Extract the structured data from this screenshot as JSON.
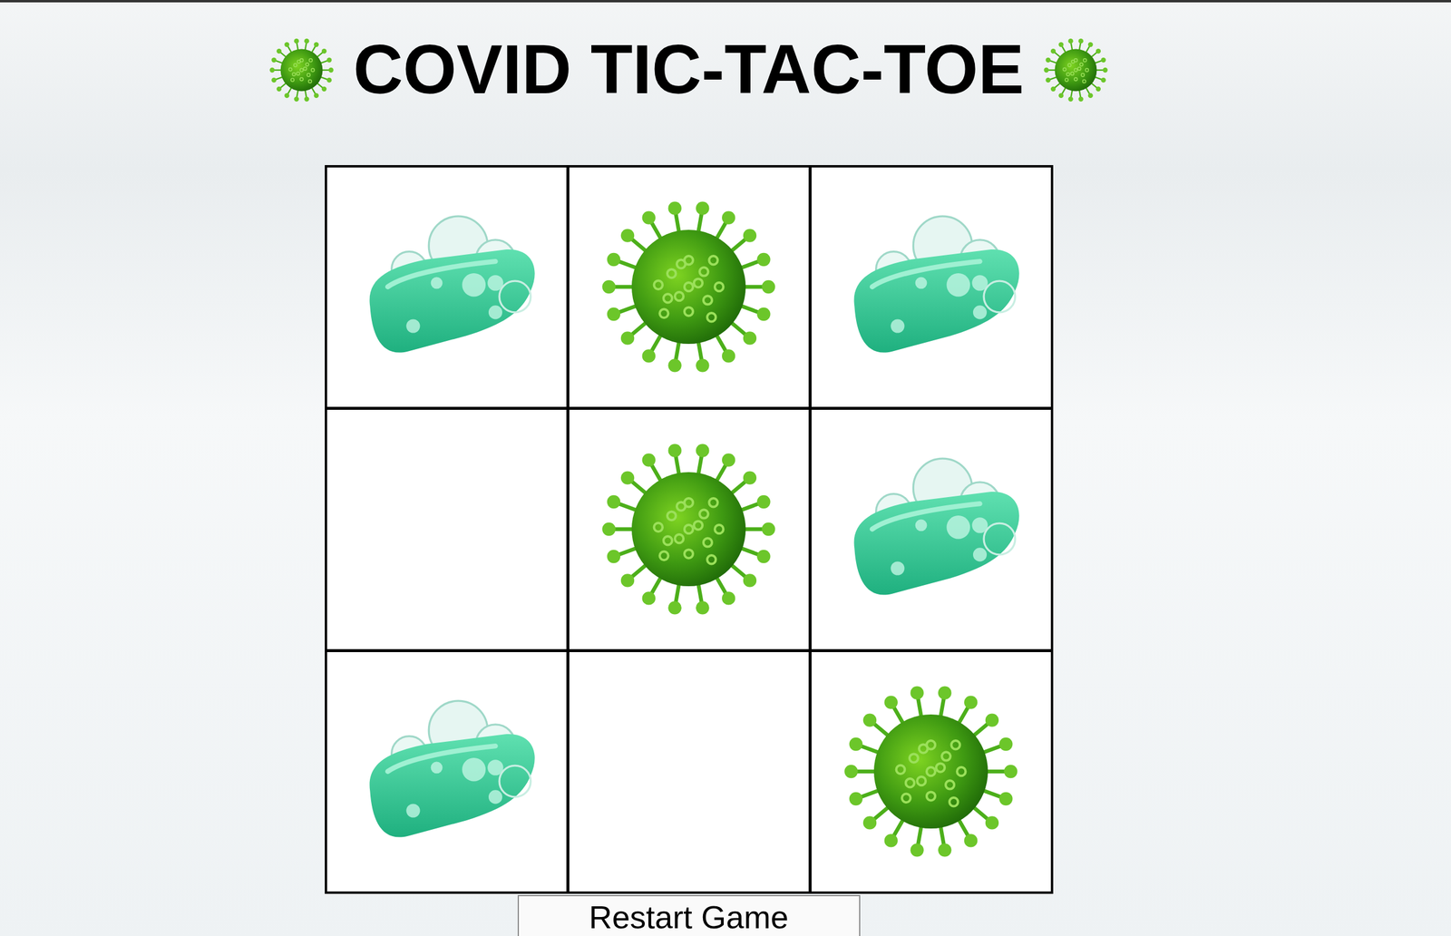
{
  "title": "COVID TIC-TAC-TOE",
  "board": {
    "cells": [
      {
        "kind": "soap"
      },
      {
        "kind": "virus"
      },
      {
        "kind": "soap"
      },
      {
        "kind": "empty"
      },
      {
        "kind": "virus"
      },
      {
        "kind": "soap"
      },
      {
        "kind": "soap"
      },
      {
        "kind": "empty"
      },
      {
        "kind": "virus"
      }
    ]
  },
  "restart_button": {
    "label": "Restart Game"
  }
}
